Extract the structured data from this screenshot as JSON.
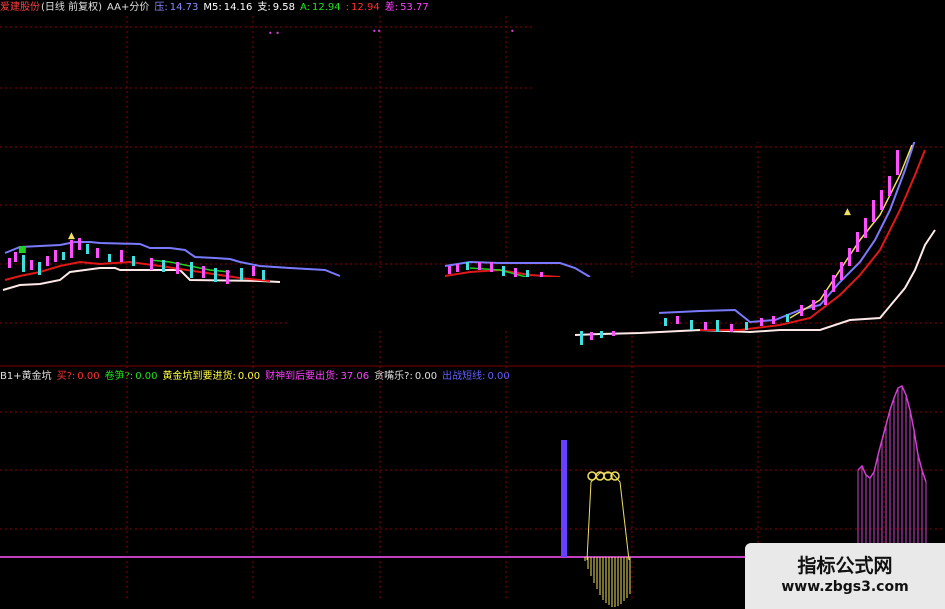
{
  "top_header": {
    "stock_name": "爱建股份",
    "period": "(日线 前复权)",
    "indicator": "AA+分价",
    "items": [
      {
        "label": "压:",
        "value": "14.73",
        "color": "#8a8aff"
      },
      {
        "label": "M5:",
        "value": "14.16",
        "color": "#ffffff"
      },
      {
        "label": "支:",
        "value": "9.58",
        "color": "#ffffff"
      },
      {
        "label": "A:",
        "value": "12.94",
        "color": "#20e020"
      },
      {
        "label": ":",
        "value": "12.94",
        "color": "#ff3030"
      },
      {
        "label": "差:",
        "value": "53.77",
        "color": "#ff40ff"
      }
    ]
  },
  "lower_header": {
    "indicator": "B1+黄金坑",
    "items": [
      {
        "label": "买?:",
        "value": "0.00",
        "color": "#ff3030"
      },
      {
        "label": "卷笋?:",
        "value": "0.00",
        "color": "#20e020"
      },
      {
        "label": "黄金坑到要进货:",
        "value": "0.00",
        "color": "#ffff40"
      },
      {
        "label": "财神到后要出货:",
        "value": "37.06",
        "color": "#ff40ff"
      },
      {
        "label": "贪嘴乐?:",
        "value": "0.00",
        "color": "#e0e0e0"
      },
      {
        "label": "出战短线:",
        "value": "0.00",
        "color": "#6060ff"
      }
    ]
  },
  "watermark": {
    "title": "指标公式网",
    "url": "www.zbgs3.com"
  },
  "colors": {
    "grid": "#8b0000",
    "pressure": "#7a7aff",
    "support": "#ffe0e0",
    "ma_red": "#e01818",
    "ma_green": "#20d020",
    "ma_yellow": "#f0e060",
    "baseline": "#c040c0",
    "bar_blue": "#6a40ff",
    "yellow_hist": "#f0e060",
    "magenta_hist": "#d040d0"
  }
}
